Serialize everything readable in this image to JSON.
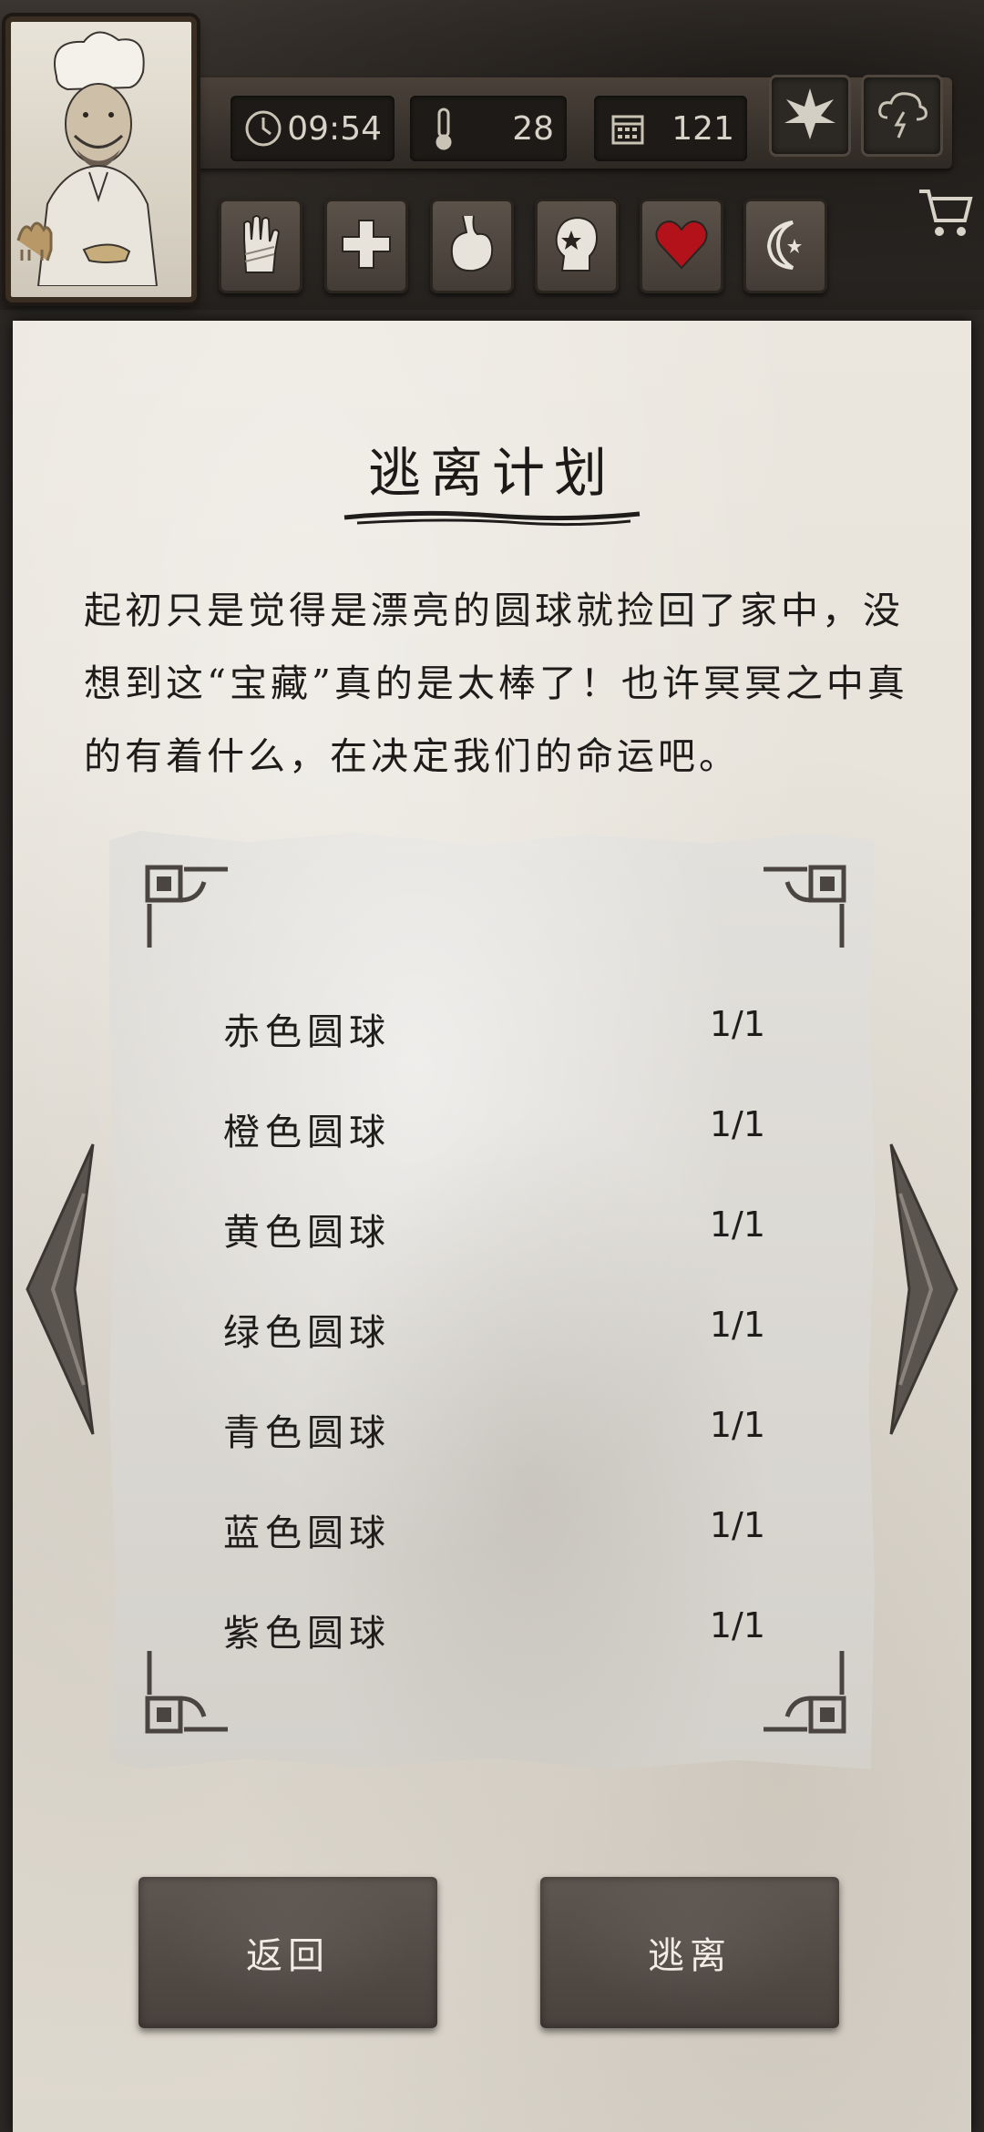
{
  "hud": {
    "time": "09:54",
    "temperature": "28",
    "day": "121",
    "icons": [
      "clock-icon",
      "thermometer-icon",
      "calendar-icon",
      "leaf-icon",
      "storm-icon",
      "cart-icon"
    ],
    "categories": [
      "hand-bandage-icon",
      "medical-cross-icon",
      "stomach-icon",
      "head-icon",
      "heart-icon",
      "moon-icon"
    ]
  },
  "panel": {
    "title": "逃离计划",
    "description": "起初只是觉得是漂亮的圆球就捡回了家中，没想到这“宝藏”真的是太棒了！也许冥冥之中真的有着什么，在决定我们的命运吧。"
  },
  "orbs": [
    {
      "name": "赤色圆球",
      "count": "1/1"
    },
    {
      "name": "橙色圆球",
      "count": "1/1"
    },
    {
      "name": "黄色圆球",
      "count": "1/1"
    },
    {
      "name": "绿色圆球",
      "count": "1/1"
    },
    {
      "name": "青色圆球",
      "count": "1/1"
    },
    {
      "name": "蓝色圆球",
      "count": "1/1"
    },
    {
      "name": "紫色圆球",
      "count": "1/1"
    }
  ],
  "buttons": {
    "back": "返回",
    "escape": "逃离"
  },
  "colors": {
    "heart": "#b3121a",
    "paper": "#e5e1d9",
    "button": "#534b45"
  }
}
